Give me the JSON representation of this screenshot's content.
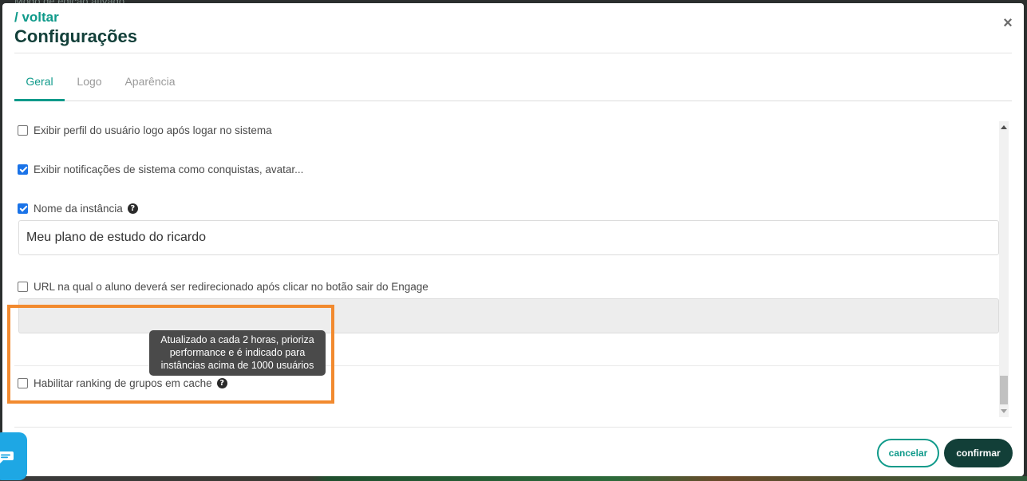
{
  "backdrop": {
    "partial_text": "Modo de edição ativado"
  },
  "header": {
    "back_link": "/ voltar",
    "title": "Configurações"
  },
  "tabs": [
    {
      "label": "Geral",
      "active": true
    },
    {
      "label": "Logo",
      "active": false
    },
    {
      "label": "Aparência",
      "active": false
    }
  ],
  "options": {
    "show_profile": {
      "label": "Exibir perfil do usuário logo após logar no sistema",
      "checked": false
    },
    "show_notifications": {
      "label": "Exibir notificações de sistema como conquistas, avatar...",
      "checked": true
    },
    "instance_name": {
      "label": "Nome da instância",
      "checked": true,
      "value": "Meu plano de estudo do ricardo"
    },
    "redirect_url": {
      "label": "URL na qual o aluno deverá ser redirecionado após clicar no botão sair do Engage",
      "checked": false,
      "value": ""
    },
    "group_ranking_cache": {
      "label": "Habilitar ranking de grupos em cache",
      "checked": false
    }
  },
  "tooltip": {
    "line1": "Atualizado a cada 2 horas, prioriza",
    "line2": "performance e é indicado para",
    "line3": "instâncias acima de 1000 usuários"
  },
  "footer": {
    "cancel_label": "cancelar",
    "confirm_label": "confirmar"
  },
  "icons": {
    "close": "close-icon",
    "help": "question-circle-icon",
    "chat": "chat-icon"
  },
  "colors": {
    "accent": "#0f9a8a",
    "title": "#13403a",
    "confirm_bg": "#123f38",
    "highlight": "#f28a2f",
    "checkbox_checked": "#1a73e8",
    "tooltip_bg": "#4a4a4a",
    "chat_widget": "#1ea7e4"
  }
}
